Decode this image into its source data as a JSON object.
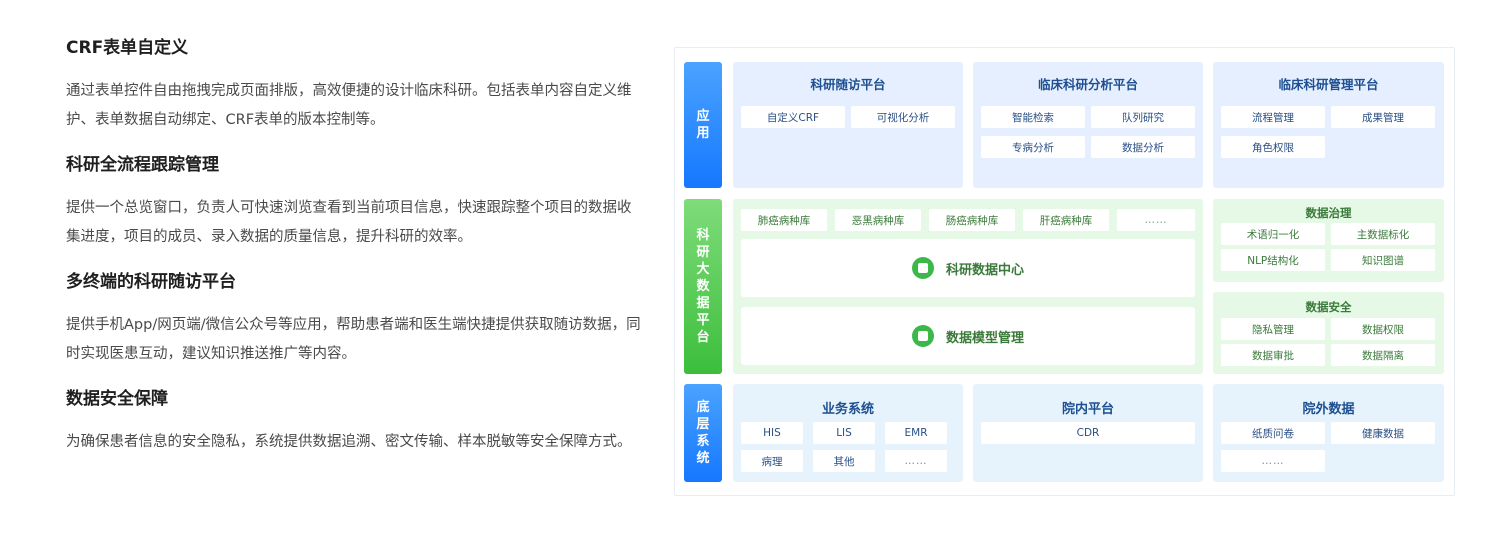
{
  "features": [
    {
      "title": "CRF表单自定义",
      "desc": "通过表单控件自由拖拽完成页面排版，高效便捷的设计临床科研。包括表单内容自定义维护、表单数据自动绑定、CRF表单的版本控制等。"
    },
    {
      "title": "科研全流程跟踪管理",
      "desc": "提供一个总览窗口，负责人可快速浏览查看到当前项目信息，快速跟踪整个项目的数据收集进度，项目的成员、录入数据的质量信息，提升科研的效率。"
    },
    {
      "title": "多终端的科研随访平台",
      "desc": "提供手机App/网页端/微信公众号等应用，帮助患者端和医生端快捷提供获取随访数据，同时实现医患互动，建议知识推送推广等内容。"
    },
    {
      "title": "数据安全保障",
      "desc": "为确保患者信息的安全隐私，系统提供数据追溯、密文传输、样本脱敏等安全保障方式。"
    }
  ],
  "diagram": {
    "layers": {
      "app": "应用",
      "sci": "科研大数据平台",
      "base": "底层系统"
    },
    "app_panels": [
      {
        "title": "科研随访平台",
        "items": [
          "自定义CRF",
          "可视化分析"
        ]
      },
      {
        "title": "临床科研分析平台",
        "items": [
          "智能检索",
          "队列研究",
          "专病分析",
          "数据分析"
        ]
      },
      {
        "title": "临床科研管理平台",
        "items": [
          "流程管理",
          "成果管理",
          "角色权限"
        ]
      }
    ],
    "sci": {
      "disease_libs": [
        "肺癌病种库",
        "恶黑病种库",
        "肠癌病种库",
        "肝癌病种库",
        "……"
      ],
      "data_center": "科研数据中心",
      "model_mgmt": "数据模型管理",
      "governance": {
        "title": "数据治理",
        "items": [
          "术语归一化",
          "主数据标化",
          "NLP结构化",
          "知识图谱"
        ]
      },
      "security": {
        "title": "数据安全",
        "items": [
          "隐私管理",
          "数据权限",
          "数据审批",
          "数据隔离"
        ]
      }
    },
    "base_panels": [
      {
        "title": "业务系统",
        "items": [
          "HIS",
          "LIS",
          "EMR",
          "病理",
          "其他",
          "……"
        ]
      },
      {
        "title": "院内平台",
        "items": [
          "CDR"
        ]
      },
      {
        "title": "院外数据",
        "items": [
          "纸质问卷",
          "健康数据",
          "……"
        ]
      }
    ]
  },
  "icons": {
    "data_center": "database-icon",
    "model_mgmt": "model-icon"
  },
  "colors": {
    "blue_accent": "#1677ff",
    "green_accent": "#3cbe3c"
  }
}
